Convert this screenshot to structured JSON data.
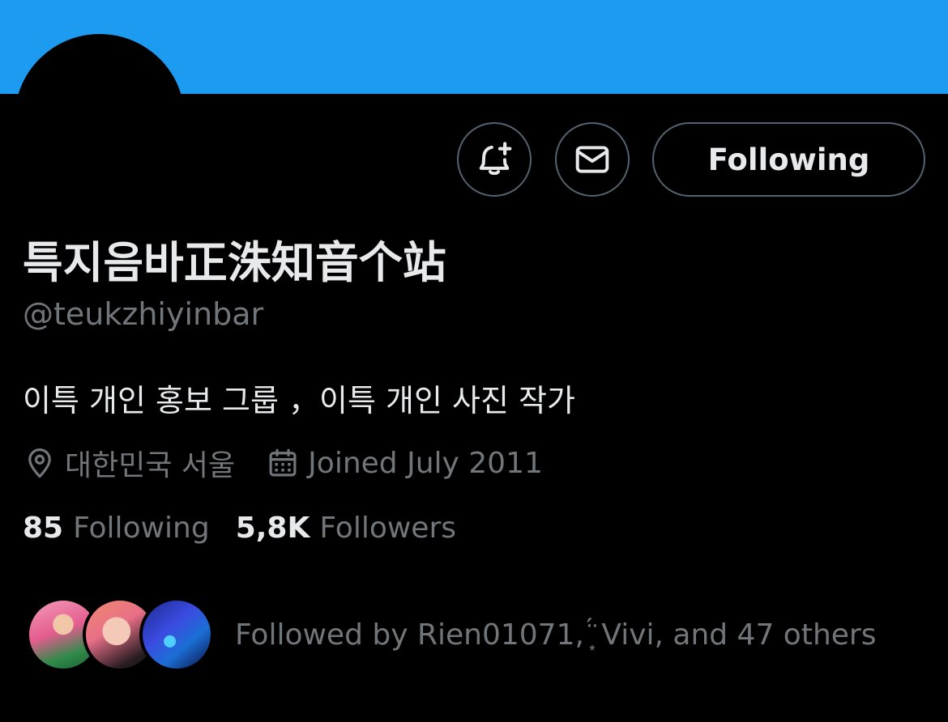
{
  "profile": {
    "name": "특지음바正洙知音个站",
    "handle": "@teukzhiyinbar",
    "bio": "이특 개인 홍보 그룹 ，이특 개인 사진 작가",
    "location": "대한민국 서울",
    "joined": "Joined July 2011"
  },
  "actions": {
    "notify_icon": "bell-plus-icon",
    "message_icon": "envelope-icon",
    "follow_label": "Following"
  },
  "stats": {
    "following_count": "85",
    "following_label": "Following",
    "followers_count": "5,8K",
    "followers_label": "Followers"
  },
  "followed_by": {
    "text": "Followed by Rien01071, ͙̈́ Vivi, and 47 others"
  },
  "colors": {
    "banner": "#1d9bf0",
    "background": "#000000",
    "primary_text": "#e7e9ea",
    "secondary_text": "#71767b",
    "button_border": "#536471"
  }
}
